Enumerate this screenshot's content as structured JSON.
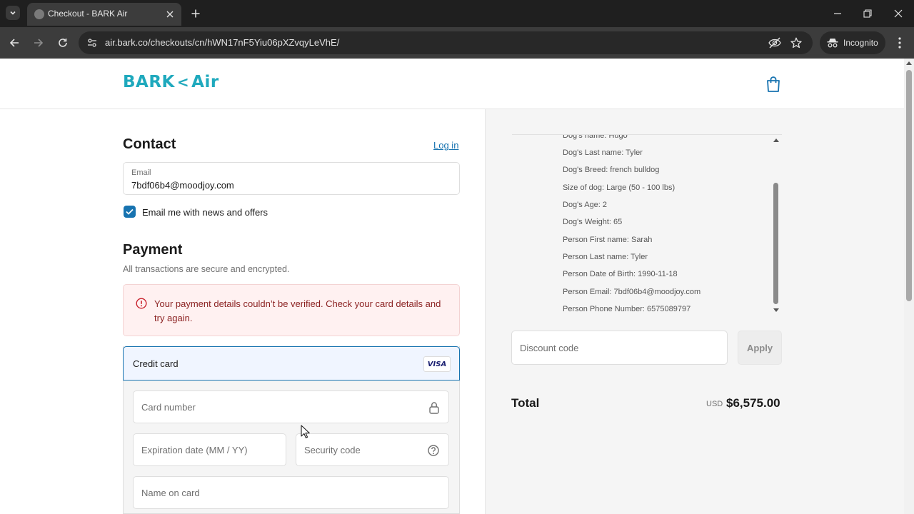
{
  "browser": {
    "tab_title": "Checkout - BARK Air",
    "url": "air.bark.co/checkouts/cn/hWN17nF5Yiu06pXZvqyLeVhE/",
    "incognito_label": "Incognito"
  },
  "header": {
    "logo_left": "BARK",
    "logo_sep": "<",
    "logo_right": "Air"
  },
  "contact": {
    "title": "Contact",
    "login_label": "Log in",
    "email_label": "Email",
    "email_value": "7bdf06b4@moodjoy.com",
    "newsletter_label": "Email me with news and offers",
    "newsletter_checked": true
  },
  "payment": {
    "title": "Payment",
    "subtitle": "All transactions are secure and encrypted.",
    "error_message": "Your payment details couldn’t be verified. Check your card details and try again.",
    "method_label": "Credit card",
    "card_brand": "VISA",
    "card_number_placeholder": "Card number",
    "expiration_placeholder": "Expiration date (MM / YY)",
    "security_code_placeholder": "Security code",
    "name_on_card_placeholder": "Name on card"
  },
  "order_details": {
    "lines": [
      "Dog's name: Hugo",
      "Dog's Last name: Tyler",
      "Dog's Breed: french bulldog",
      "Size of dog: Large (50 - 100 lbs)",
      "Dog's Age: 2",
      "Dog's Weight: 65",
      "Person First name: Sarah",
      "Person Last name: Tyler",
      "Person Date of Birth: 1990-11-18",
      "Person Email: 7bdf06b4@moodjoy.com",
      "Person Phone Number: 6575089797"
    ]
  },
  "discount": {
    "placeholder": "Discount code",
    "apply_label": "Apply"
  },
  "summary": {
    "total_label": "Total",
    "currency": "USD",
    "total_amount": "$6,575.00"
  },
  "colors": {
    "brand": "#1fa9bd",
    "link": "#1773b0",
    "error_bg": "#fff1f1",
    "error_text": "#8a1f1f"
  }
}
